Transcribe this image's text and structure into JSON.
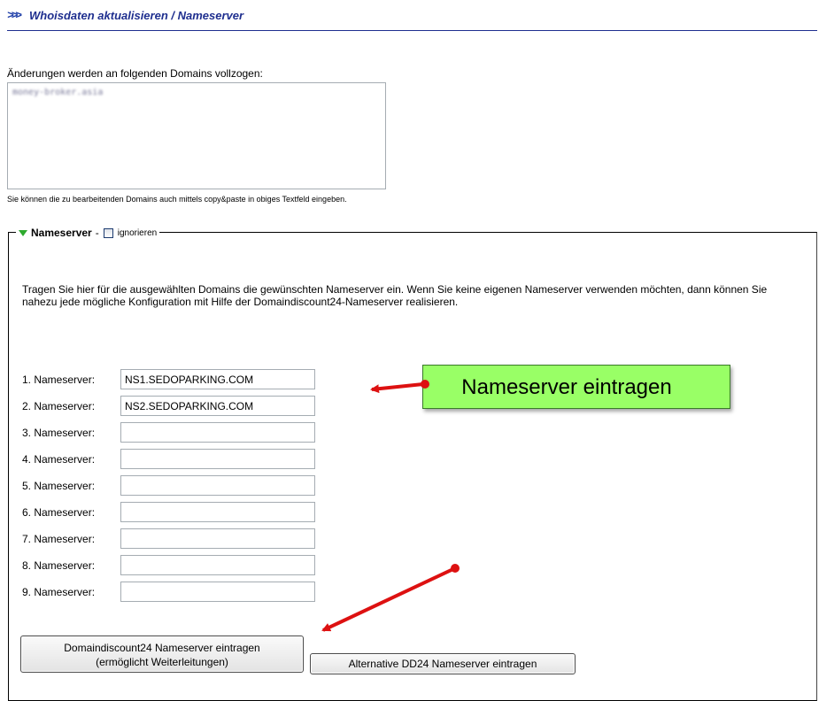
{
  "header": {
    "chevrons": ">>>",
    "title": "Whoisdaten aktualisieren / Nameserver"
  },
  "domains": {
    "intro": "Änderungen werden an folgenden Domains vollzogen:",
    "entry": "money-broker.asia",
    "hint": "Sie können die zu bearbeitenden Domains auch mittels copy&paste in obiges Textfeld eingeben."
  },
  "nameserver_section": {
    "legend": "Nameserver",
    "separator": "-",
    "ignore_label": "ignorieren",
    "ignore_checked": false,
    "description": "Tragen Sie hier für die ausgewählten Domains die gewünschten Nameserver ein. Wenn Sie keine eigenen Nameserver verwenden möchten, dann können Sie nahezu jede mögliche Konfiguration mit Hilfe der Domaindiscount24-Nameserver realisieren.",
    "rows": [
      {
        "label": "1. Nameserver:",
        "value": "NS1.SEDOPARKING.COM"
      },
      {
        "label": "2. Nameserver:",
        "value": "NS2.SEDOPARKING.COM"
      },
      {
        "label": "3. Nameserver:",
        "value": ""
      },
      {
        "label": "4. Nameserver:",
        "value": ""
      },
      {
        "label": "5. Nameserver:",
        "value": ""
      },
      {
        "label": "6. Nameserver:",
        "value": ""
      },
      {
        "label": "7. Nameserver:",
        "value": ""
      },
      {
        "label": "8. Nameserver:",
        "value": ""
      },
      {
        "label": "9. Nameserver:",
        "value": ""
      }
    ]
  },
  "callout": {
    "text": "Nameserver eintragen",
    "color": "#99ff66"
  },
  "buttons": {
    "dd24_line1": "Domaindiscount24 Nameserver eintragen",
    "dd24_line2": "(ermöglicht Weiterleitungen)",
    "alternative": "Alternative DD24 Nameserver eintragen"
  },
  "colors": {
    "title": "#1f2f8f",
    "arrow": "#dd1111",
    "triangle": "#2eaa2e"
  }
}
